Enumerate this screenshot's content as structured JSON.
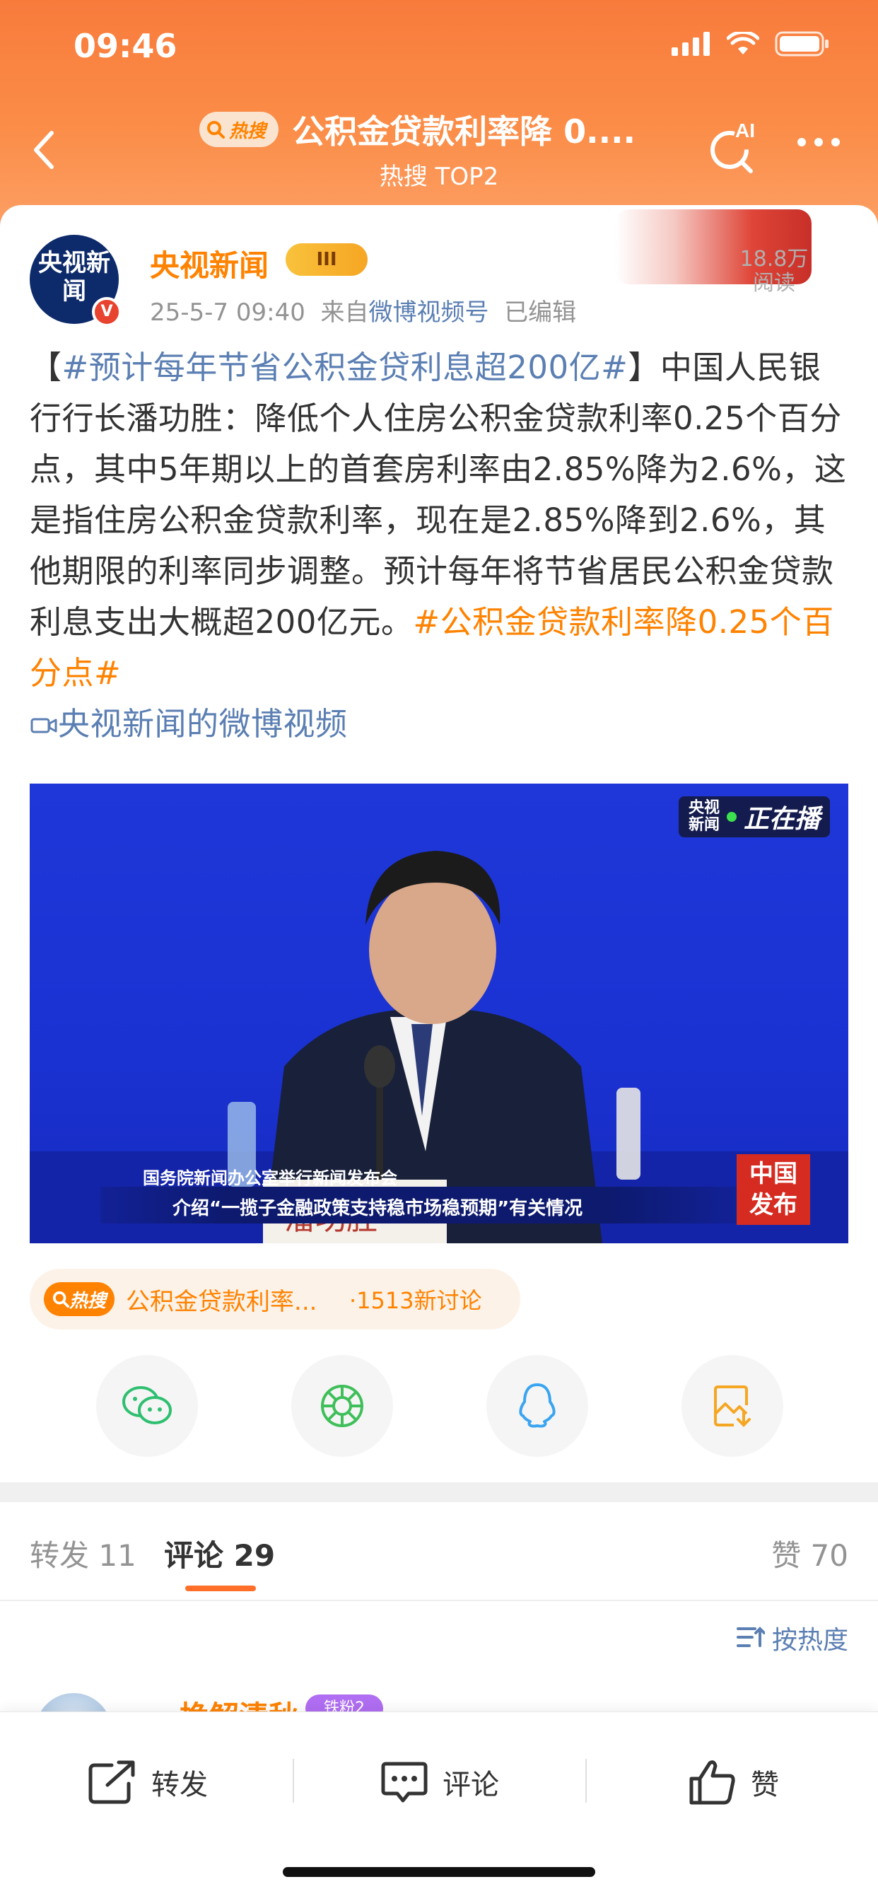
{
  "status_bar": {
    "time": "09:46"
  },
  "nav": {
    "hot_label": "热搜",
    "title": "公积金贷款利率降 0....",
    "subtitle": "热搜 TOP2",
    "ai_label": "AI"
  },
  "post": {
    "author": "央视新闻",
    "avatar_text": "央视新闻",
    "level": "III",
    "time": "25-5-7 09:40",
    "source_prefix": "来自",
    "source": "微博视频号",
    "edited": "已编辑",
    "reads": "18.8万",
    "reads_label": "阅读",
    "text": {
      "open_bracket": "【",
      "topic": "#预计每年节省公积金贷利息超200亿#",
      "close_bracket": "】",
      "body": "中国人民银行行长潘功胜：降低个人住房公积金贷款利率0.25个百分点，其中5年期以上的首套房利率由2.85%降为2.6%，这是指住房公积金贷款利率，现在是2.85%降到2.6%，其他期限的利率同步调整。预计每年将节省居民公积金贷款利息支出大概超200亿元。",
      "tag": "#公积金贷款利率降0.25个百分点#",
      "video_link": "央视新闻的微博视频"
    },
    "video": {
      "live_small_1": "央视",
      "live_small_2": "新闻",
      "live_text": "正在播",
      "caption_1": "国务院新闻办公室举行新闻发布会",
      "caption_2": "介绍“一揽子金融政策支持稳市场稳预期”有关情况",
      "logo_1": "中国",
      "logo_2": "发布",
      "nameplate": "潘功胜"
    },
    "hot_topic": {
      "label": "热搜",
      "title": "公积金贷款利率...",
      "count": "·1513新讨论"
    }
  },
  "tabs": {
    "repost": "转发 11",
    "comment": "评论 29",
    "like": "赞 70"
  },
  "sort_label": "按热度",
  "comment_peek": {
    "name": "一挽解清秋",
    "badge": "铁粉2"
  },
  "bottom_bar": {
    "repost": "转发",
    "comment": "评论",
    "like": "赞"
  },
  "share_icons": [
    "wechat-icon",
    "moments-icon",
    "qq-icon",
    "save-image-icon"
  ],
  "colors": {
    "accent": "#ff8200",
    "link": "#5b7fb3",
    "header": "#f87b3c"
  }
}
